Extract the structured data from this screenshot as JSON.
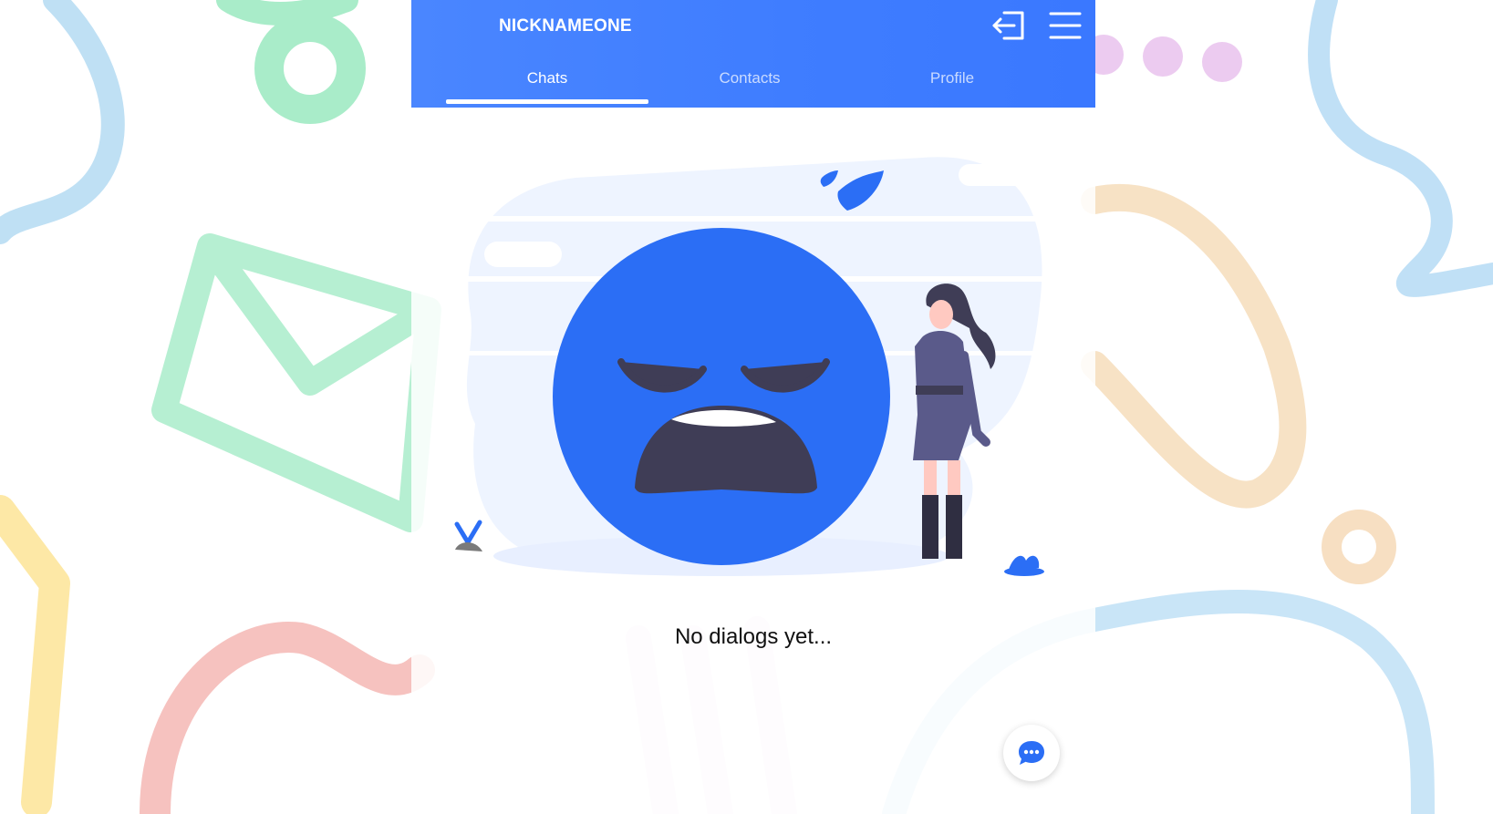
{
  "header": {
    "title": "NICKNAMEONE",
    "logout_icon": "logout-icon",
    "menu_icon": "hamburger-menu-icon"
  },
  "tabs": [
    {
      "label": "Chats",
      "active": true
    },
    {
      "label": "Contacts",
      "active": false
    },
    {
      "label": "Profile",
      "active": false
    }
  ],
  "main": {
    "empty_message": "No dialogs yet...",
    "illustration": "sad-face-illustration"
  },
  "fab": {
    "icon": "chat-bubble-icon"
  },
  "colors": {
    "primary": "#3f7dff",
    "face": "#2b6ef5",
    "mouth": "#3f3d56"
  }
}
